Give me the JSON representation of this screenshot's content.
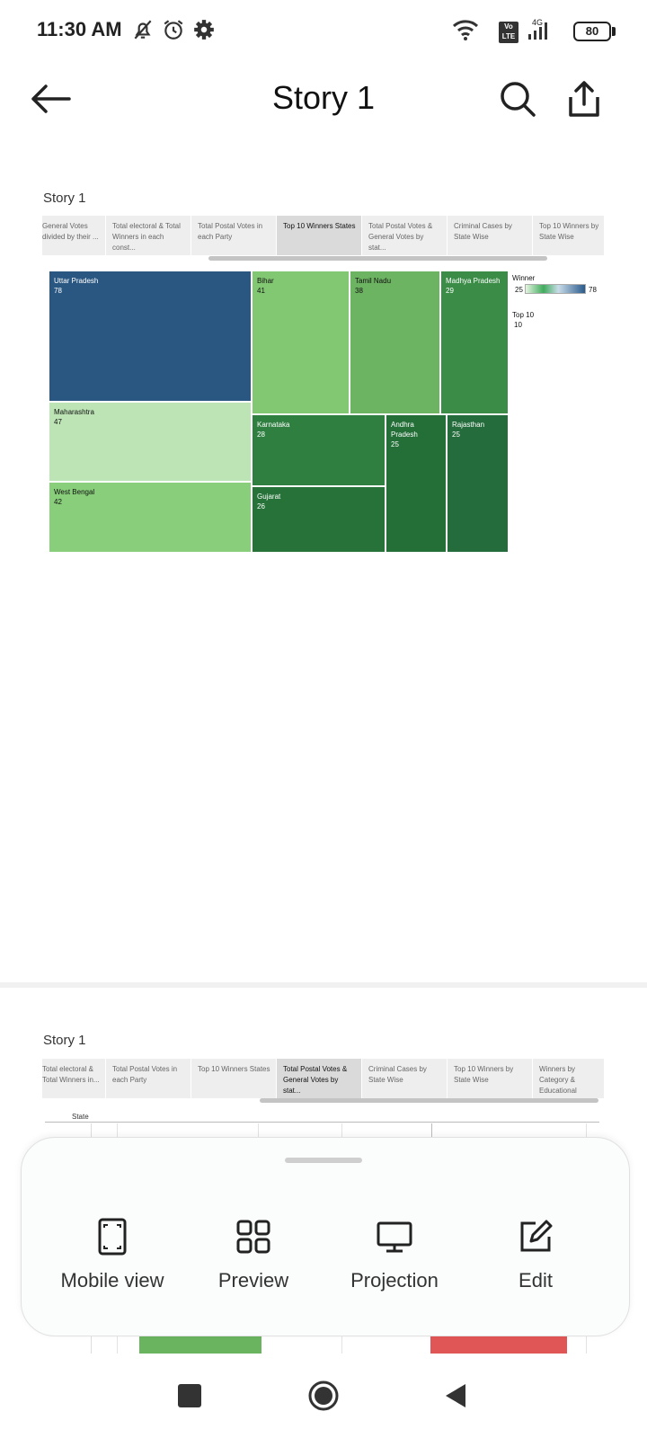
{
  "status_bar": {
    "time": "11:30 AM",
    "icons": [
      "mute-icon",
      "alarm-icon",
      "settings-gear-icon",
      "wifi-icon",
      "volte-icon",
      "signal-icon"
    ],
    "volte": "Vo\nLTE",
    "network": "4G",
    "battery": "80"
  },
  "header": {
    "title": "Story 1",
    "back_icon": "back-arrow-icon",
    "search_icon": "search-icon",
    "share_icon": "share-icon"
  },
  "story_card_1": {
    "label": "Story 1",
    "tabs": [
      {
        "label": "General Votes divided by their ..."
      },
      {
        "label": "Total electoral & Total Winners in each const..."
      },
      {
        "label": "Total Postal Votes in each Party"
      },
      {
        "label": "Top 10 Winners States",
        "active": true
      },
      {
        "label": "Total Postal Votes & General Votes by stat..."
      },
      {
        "label": "Criminal Cases by State Wise"
      },
      {
        "label": "Top 10 Winners by State Wise"
      }
    ]
  },
  "chart_data": {
    "type": "treemap",
    "items": [
      {
        "name": "Uttar Pradesh",
        "value": 78,
        "color": "#2a5782"
      },
      {
        "name": "Maharashtra",
        "value": 47,
        "color": "#bce4b5"
      },
      {
        "name": "West Bengal",
        "value": 42,
        "color": "#88ce7b"
      },
      {
        "name": "Bihar",
        "value": 41,
        "color": "#82c772"
      },
      {
        "name": "Tamil Nadu",
        "value": 38,
        "color": "#6db462"
      },
      {
        "name": "Madhya Pradesh",
        "value": 29,
        "color": "#3a8c47"
      },
      {
        "name": "Karnataka",
        "value": 28,
        "color": "#2f7f40"
      },
      {
        "name": "Gujarat",
        "value": 26,
        "color": "#267238"
      },
      {
        "name": "Andhra Pradesh",
        "value": 25,
        "color": "#246e38"
      },
      {
        "name": "Rajasthan",
        "value": 25,
        "color": "#246c3b"
      }
    ],
    "legend": {
      "title": "Winner",
      "min": "25",
      "max": "78"
    },
    "filter": {
      "title": "Top 10",
      "value": "10"
    }
  },
  "story_card_2": {
    "label": "Story 1",
    "tabs": [
      {
        "label": "Total electoral & Total Winners in..."
      },
      {
        "label": "Total Postal Votes in each Party"
      },
      {
        "label": "Top 10 Winners States"
      },
      {
        "label": "Total Postal Votes & General Votes by stat...",
        "active": true
      },
      {
        "label": "Criminal Cases by State Wise"
      },
      {
        "label": "Top 10 Winners by State Wise"
      },
      {
        "label": "Winners by Category & Educational Quali..."
      }
    ],
    "column_header": "State",
    "bar_colors": [
      "#6ab35f",
      "#e05656"
    ]
  },
  "bottom_sheet": {
    "actions": [
      {
        "label": "Mobile view",
        "icon": "mobile-view-icon"
      },
      {
        "label": "Preview",
        "icon": "preview-grid-icon"
      },
      {
        "label": "Projection",
        "icon": "projection-monitor-icon"
      },
      {
        "label": "Edit",
        "icon": "edit-icon"
      }
    ]
  },
  "nav_bar": {
    "recents_icon": "recents-square-icon",
    "home_icon": "home-circle-icon",
    "back_icon": "back-triangle-icon"
  }
}
